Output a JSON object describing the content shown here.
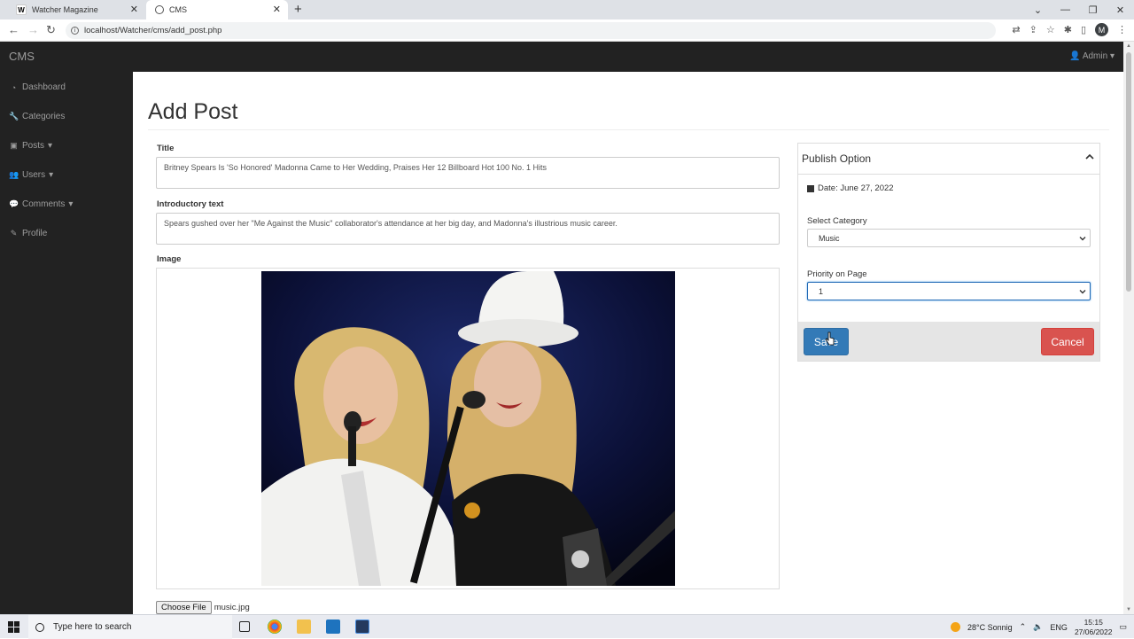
{
  "browser": {
    "tabs": [
      {
        "label": "Watcher Magazine",
        "favicon": "W",
        "active": false
      },
      {
        "label": "CMS",
        "active": true
      }
    ],
    "url": "localhost/Watcher/cms/add_post.php",
    "profile_initial": "M"
  },
  "navbar": {
    "brand": "CMS",
    "user_menu": "Admin"
  },
  "sidebar": {
    "items": [
      {
        "label": "Dashboard",
        "icon": "dashboard-icon"
      },
      {
        "label": "Categories",
        "icon": "wrench-icon"
      },
      {
        "label": "Posts",
        "icon": "image-icon",
        "dropdown": true
      },
      {
        "label": "Users",
        "icon": "users-icon",
        "dropdown": true
      },
      {
        "label": "Comments",
        "icon": "comment-icon",
        "dropdown": true
      },
      {
        "label": "Profile",
        "icon": "edit-icon"
      }
    ]
  },
  "form": {
    "page_title": "Add Post",
    "title_label": "Title",
    "title_value": "Britney Spears Is 'So Honored' Madonna Came to Her Wedding, Praises Her 12 Billboard Hot 100 No. 1 Hits",
    "intro_label": "Introductory text",
    "intro_value": "Spears gushed over her \"Me Against the Music\" collaborator's attendance at her big day, and Madonna's illustrious music career.",
    "image_label": "Image",
    "file_button": "Choose File",
    "file_name": "music.jpg"
  },
  "publish": {
    "heading": "Publish Option",
    "date_text": "Date: June 27, 2022",
    "category_label": "Select Category",
    "category_value": "Music",
    "priority_label": "Priority on Page",
    "priority_value": "1",
    "save_label": "Save",
    "cancel_label": "Cancel"
  },
  "taskbar": {
    "search_placeholder": "Type here to search",
    "weather": "28°C  Sonnig",
    "language": "ENG",
    "time": "15:15",
    "date": "27/06/2022"
  },
  "colors": {
    "navbar_bg": "#222222",
    "primary": "#337ab7",
    "danger": "#d9534f"
  }
}
